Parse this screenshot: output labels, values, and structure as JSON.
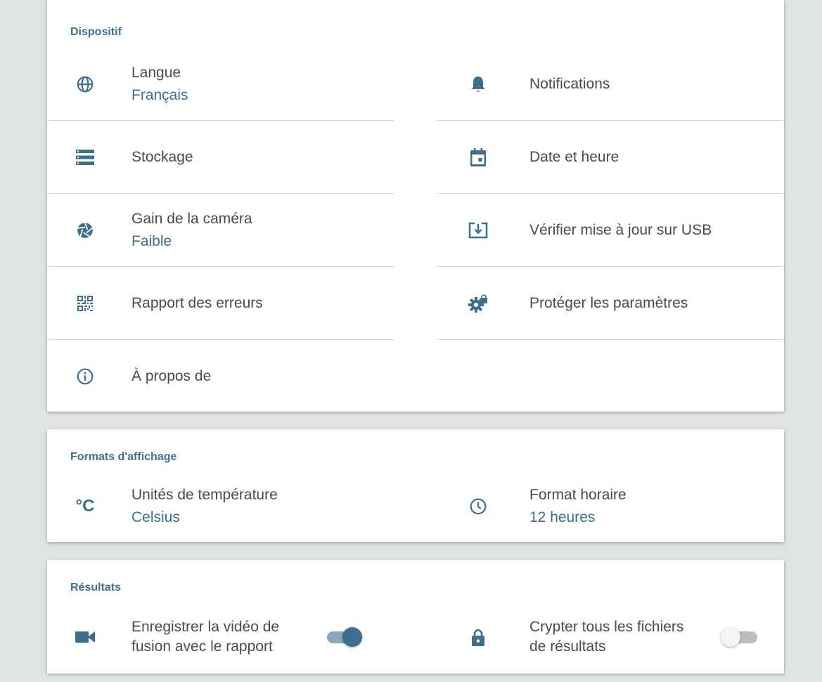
{
  "colors": {
    "accent": "#3d6e8c",
    "icon": "#3d6e8c",
    "background": "#dfe3e3",
    "card": "#ffffff"
  },
  "device": {
    "title": "Dispositif",
    "items": [
      {
        "label": "Langue",
        "value": "Français",
        "icon": "globe-icon"
      },
      {
        "label": "Notifications",
        "icon": "bell-icon"
      },
      {
        "label": "Stockage",
        "icon": "storage-icon"
      },
      {
        "label": "Date et heure",
        "icon": "calendar-icon"
      },
      {
        "label": "Gain de la caméra",
        "value": "Faible",
        "icon": "camera-aperture-icon"
      },
      {
        "label": "Vérifier mise à jour sur USB",
        "icon": "download-icon"
      },
      {
        "label": "Rapport des erreurs",
        "icon": "qr-code-icon"
      },
      {
        "label": "Protéger les paramètres",
        "icon": "gear-lock-icon"
      },
      {
        "label": "À propos de",
        "icon": "info-icon"
      }
    ]
  },
  "display": {
    "title": "Formats d'affichage",
    "items": [
      {
        "label": "Unités de température",
        "value": "Celsius",
        "icon": "celsius-icon",
        "icon_text": "°C"
      },
      {
        "label": "Format horaire",
        "value": "12 heures",
        "icon": "clock-icon"
      }
    ]
  },
  "results": {
    "title": "Résultats",
    "items": [
      {
        "label": "Enregistrer la vidéo de fusion avec le rapport",
        "icon": "video-camera-icon",
        "enabled": true
      },
      {
        "label": "Crypter tous les fichiers de résultats",
        "icon": "lock-icon",
        "enabled": false
      }
    ]
  }
}
